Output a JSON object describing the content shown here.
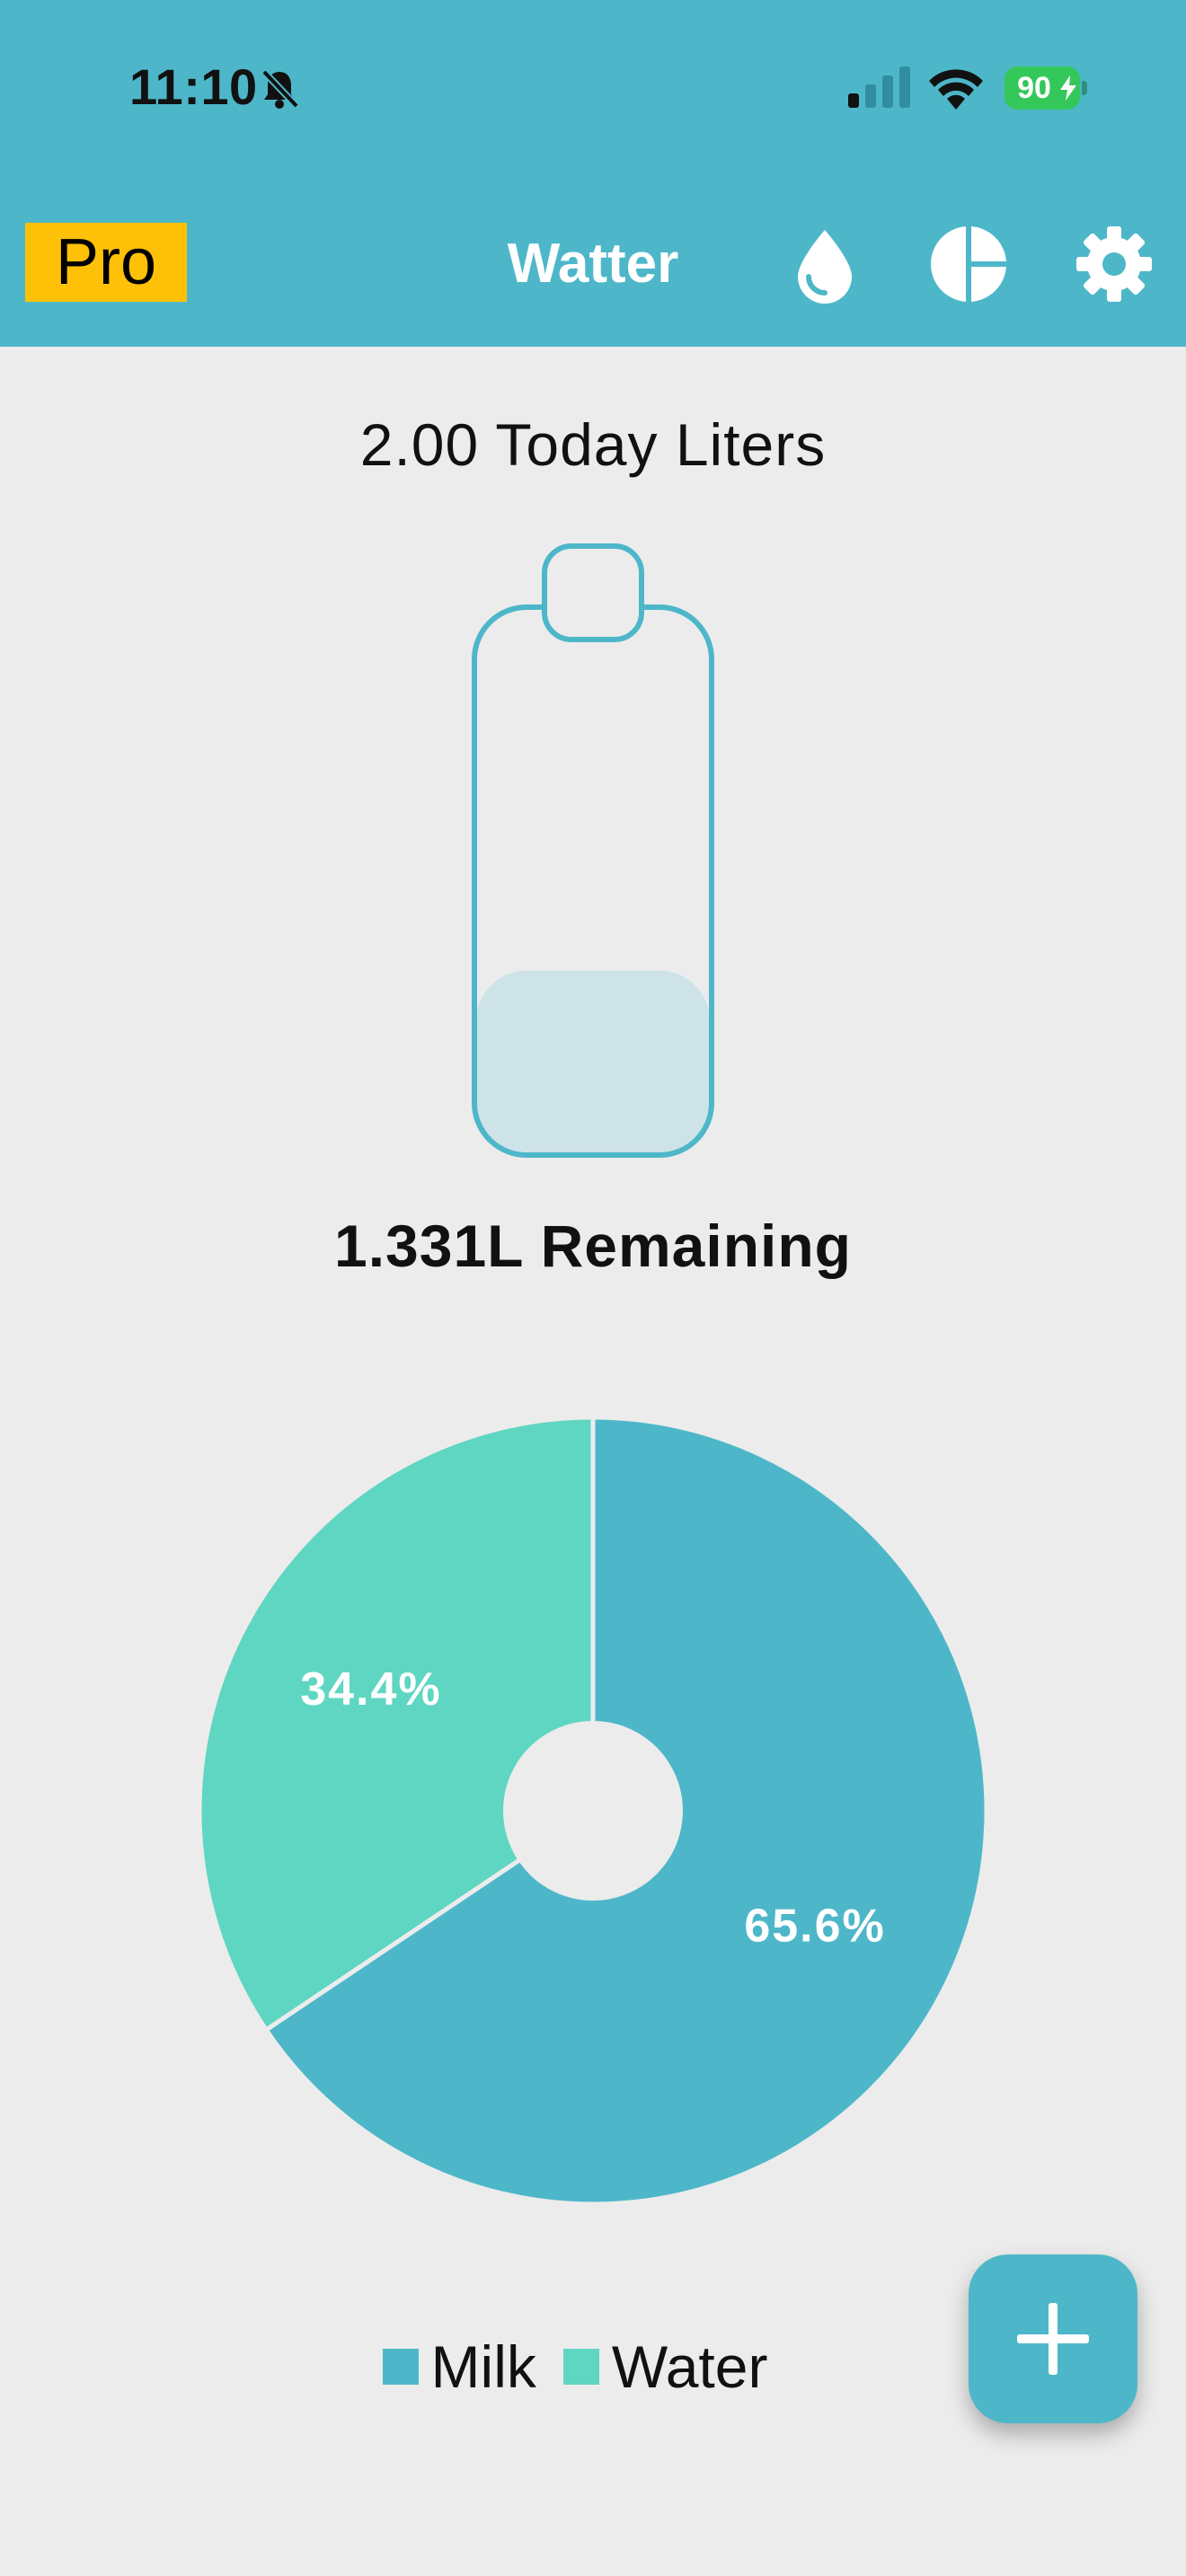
{
  "colors": {
    "header_bg": "#4db7c9",
    "pro_badge_bg": "#ffc107",
    "milk": "#4db7c9",
    "water": "#5fd6c2",
    "bottle_outline": "#4db7c9",
    "bottle_fill": "#cde3e8",
    "page_bg": "#ececec"
  },
  "status_bar": {
    "time": "11:10",
    "battery": "90",
    "icons": [
      "bell-slash-icon",
      "cellular-signal-icon",
      "wifi-icon",
      "battery-charging-icon"
    ]
  },
  "app_bar": {
    "pro_label": "Pro",
    "title": "Watter",
    "icons": [
      "water-drop-icon",
      "pie-chart-icon",
      "gear-icon"
    ]
  },
  "summary": {
    "today_text": "2.00 Today Liters",
    "remaining_text": "1.331L Remaining",
    "bottle_fill_fraction": 0.335
  },
  "chart_data": {
    "type": "pie",
    "title": "",
    "slices": [
      {
        "label": "Milk",
        "value": 65.6,
        "display": "65.6%",
        "color": "#4db7c9"
      },
      {
        "label": "Water",
        "value": 34.4,
        "display": "34.4%",
        "color": "#5fd6c2"
      }
    ],
    "legend_position": "bottom"
  },
  "fab": {
    "icon": "plus-icon"
  }
}
